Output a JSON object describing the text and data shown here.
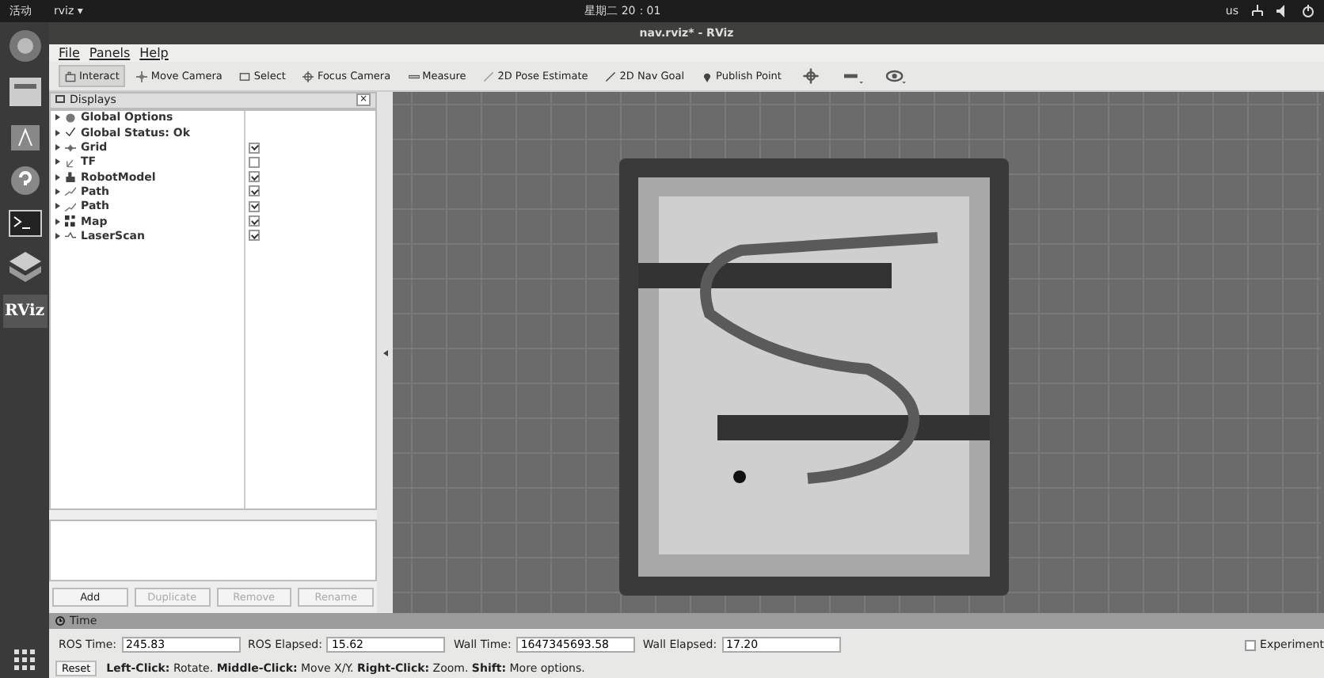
{
  "top_bar": {
    "activities": "活动",
    "app_menu": "rviz ▾",
    "clock": "星期二 20：01",
    "keyboard": "us"
  },
  "dock": {
    "logo_text": "RViz"
  },
  "window": {
    "title": "nav.rviz* - RViz"
  },
  "menu": [
    "File",
    "Panels",
    "Help"
  ],
  "toolbar": [
    {
      "label": "Interact",
      "kind": "interact",
      "selected": true
    },
    {
      "label": "Move Camera",
      "kind": "move",
      "selected": false
    },
    {
      "label": "Select",
      "kind": "select",
      "selected": false
    },
    {
      "label": "Focus Camera",
      "kind": "focus",
      "selected": false
    },
    {
      "label": "Measure",
      "kind": "measure",
      "selected": false
    },
    {
      "label": "2D Pose Estimate",
      "kind": "pose",
      "selected": false
    },
    {
      "label": "2D Nav Goal",
      "kind": "goal",
      "selected": false
    },
    {
      "label": "Publish Point",
      "kind": "point",
      "selected": false
    }
  ],
  "displays": {
    "title": "Displays",
    "close": "×",
    "items": [
      {
        "label": "Global Options",
        "kind": "options"
      },
      {
        "label": "Global Status: Ok",
        "kind": "status"
      },
      {
        "label": "Grid",
        "kind": "grid",
        "checked": true
      },
      {
        "label": "TF",
        "kind": "tf",
        "checked": false
      },
      {
        "label": "RobotModel",
        "kind": "robot",
        "checked": true
      },
      {
        "label": "Path",
        "kind": "path",
        "checked": true
      },
      {
        "label": "Path",
        "kind": "path",
        "checked": true
      },
      {
        "label": "Map",
        "kind": "map",
        "checked": true
      },
      {
        "label": "LaserScan",
        "kind": "laser",
        "checked": true
      }
    ],
    "buttons": [
      {
        "label": "Add",
        "disabled": false
      },
      {
        "label": "Duplicate",
        "disabled": true
      },
      {
        "label": "Remove",
        "disabled": true
      },
      {
        "label": "Rename",
        "disabled": true
      }
    ]
  },
  "time": {
    "title": "Time",
    "fields": [
      {
        "label": "ROS Time:",
        "value": "245.83"
      },
      {
        "label": "ROS Elapsed:",
        "value": "15.62"
      },
      {
        "label": "Wall Time:",
        "value": "1647345693.58"
      },
      {
        "label": "Wall Elapsed:",
        "value": "17.20"
      }
    ],
    "experimental": {
      "label": "Experiment",
      "checked": false
    }
  },
  "status_bar": {
    "reset": "Reset",
    "hint": "**Left-Click:** Rotate. **Middle-Click:** Move X/Y. **Right-Click:** Zoom. **Shift:** More options."
  }
}
